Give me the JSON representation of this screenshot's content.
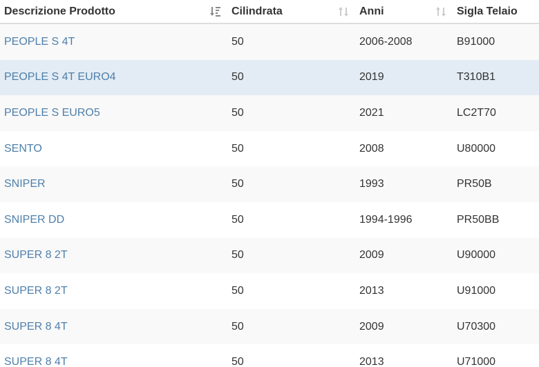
{
  "table": {
    "headers": [
      {
        "label": "Descrizione Prodotto",
        "sort": "active-desc"
      },
      {
        "label": "Cilindrata",
        "sort": "both"
      },
      {
        "label": "Anni",
        "sort": "both"
      },
      {
        "label": "Sigla Telaio",
        "sort": "none"
      }
    ],
    "rows": [
      {
        "descrizione": "PEOPLE S 4T",
        "cilindrata": "50",
        "anni": "2006-2008",
        "sigla": "B91000"
      },
      {
        "descrizione": "PEOPLE S 4T EURO4",
        "cilindrata": "50",
        "anni": "2019",
        "sigla": "T310B1"
      },
      {
        "descrizione": "PEOPLE S EURO5",
        "cilindrata": "50",
        "anni": "2021",
        "sigla": "LC2T70"
      },
      {
        "descrizione": "SENTO",
        "cilindrata": "50",
        "anni": "2008",
        "sigla": "U80000"
      },
      {
        "descrizione": "SNIPER",
        "cilindrata": "50",
        "anni": "1993",
        "sigla": "PR50B"
      },
      {
        "descrizione": "SNIPER DD",
        "cilindrata": "50",
        "anni": "1994-1996",
        "sigla": "PR50BB"
      },
      {
        "descrizione": "SUPER 8 2T",
        "cilindrata": "50",
        "anni": "2009",
        "sigla": "U90000"
      },
      {
        "descrizione": "SUPER 8 2T",
        "cilindrata": "50",
        "anni": "2013",
        "sigla": "U91000"
      },
      {
        "descrizione": "SUPER 8 4T",
        "cilindrata": "50",
        "anni": "2009",
        "sigla": "U70300"
      },
      {
        "descrizione": "SUPER 8 4T",
        "cilindrata": "50",
        "anni": "2013",
        "sigla": "U71000"
      }
    ],
    "highlighted_row": 1
  },
  "colors": {
    "link": "#4e7fab",
    "row_hover": "#e3ecf4",
    "row_striped": "#f9f9f9",
    "sort_active": "#888888",
    "sort_inactive": "#cccccc"
  }
}
